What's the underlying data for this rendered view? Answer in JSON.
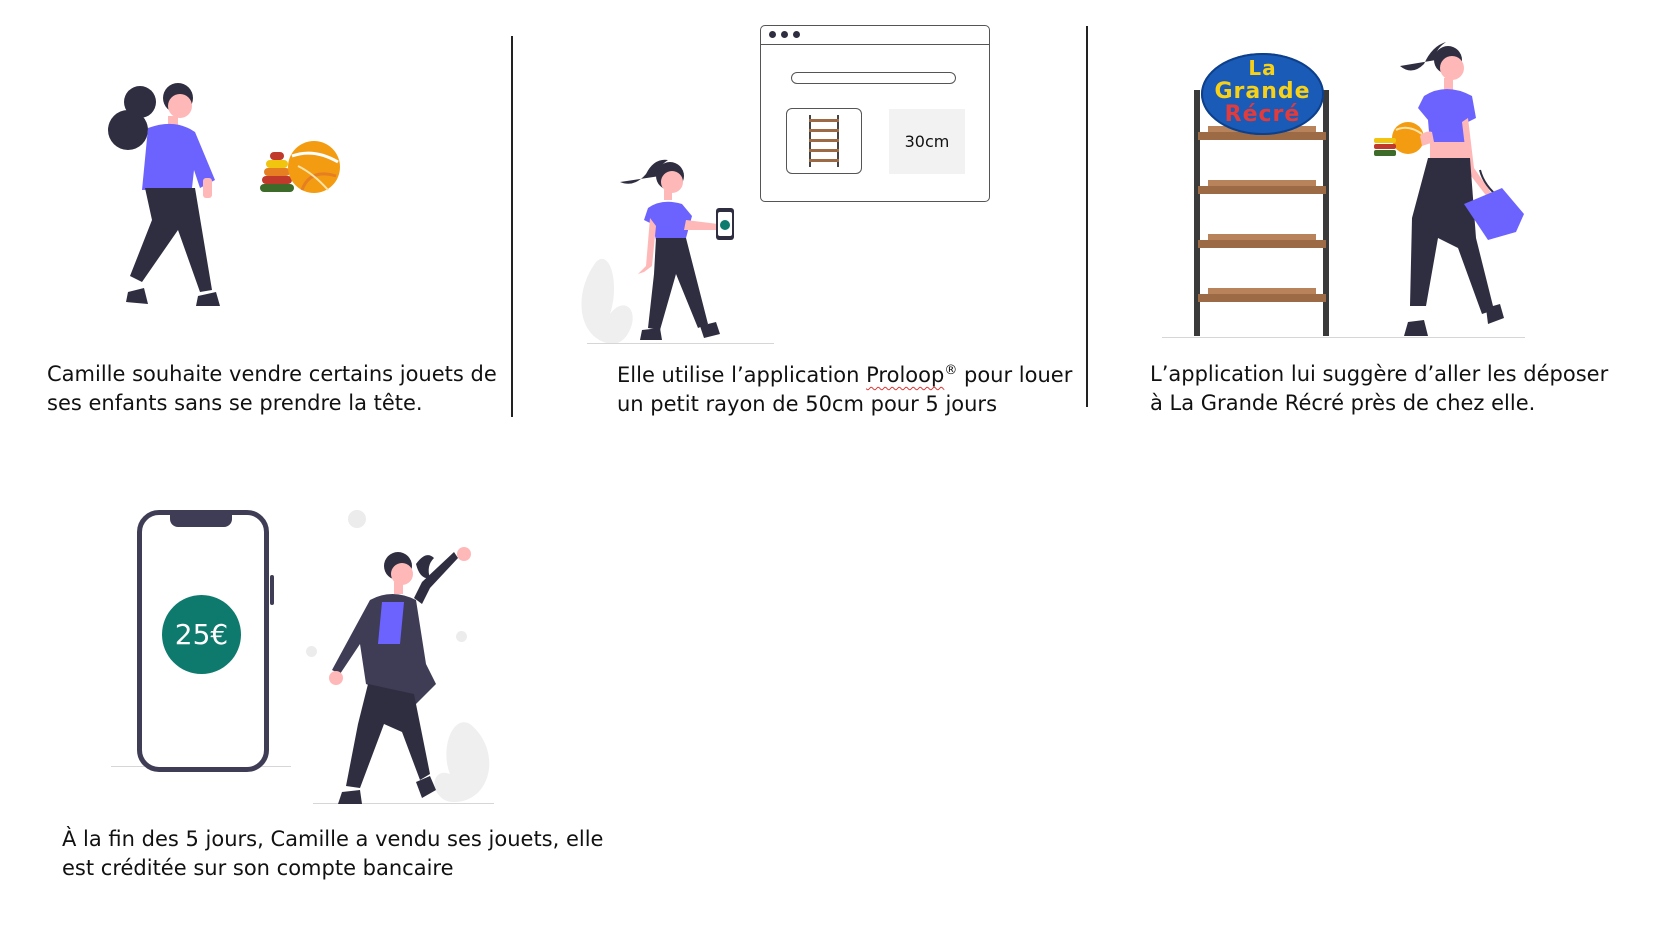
{
  "panels": [
    {
      "caption_lines": [
        "Camille souhaite vendre certains jouets de",
        "ses enfants sans se prendre la tête."
      ]
    },
    {
      "caption_before": "Elle utilise l’application ",
      "brand": "Proloop",
      "reg": "®",
      "caption_after": " pour louer",
      "caption_line2": "un petit rayon de 50cm pour 5 jours"
    },
    {
      "caption_lines": [
        "L’application lui suggère d’aller les déposer",
        "à La Grande Récré près de chez elle."
      ]
    },
    {
      "caption_lines": [
        "À la fin des 5 jours, Camille a vendu ses jouets, elle",
        "est créditée sur son compte bancaire"
      ]
    }
  ],
  "browser_mock": {
    "size_label": "30cm"
  },
  "store_logo": {
    "word1": "La",
    "word2": "Grande",
    "word3": "Récré"
  },
  "phone": {
    "amount": "25€"
  },
  "colors": {
    "shirt": "#6c63ff",
    "dark": "#2f2e41",
    "skin": "#ffb8b8",
    "accent_green": "#0e7a6e",
    "shelf_wood": "#9c6b45",
    "logo_blue": "#1a5bb8"
  },
  "icons": [
    "woman-standing-illustration",
    "toys-icon",
    "woman-with-phone-illustration",
    "browser-window-icon",
    "shelf-icon",
    "store-shelf-illustration",
    "woman-with-basket-illustration",
    "smartphone-icon",
    "woman-celebrating-illustration"
  ]
}
